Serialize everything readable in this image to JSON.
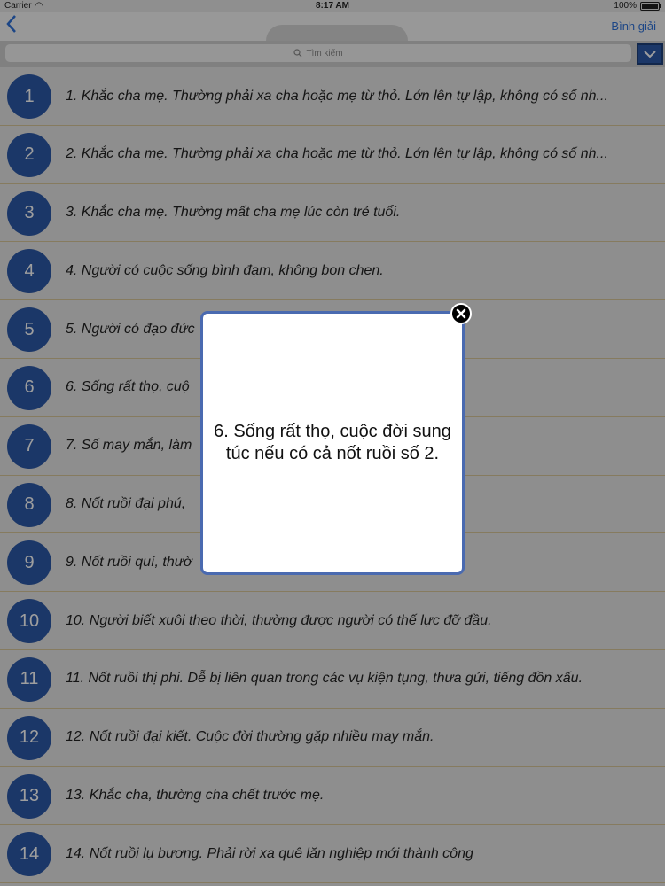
{
  "status_bar": {
    "carrier": "Carrier",
    "time": "8:17 AM",
    "battery": "100%"
  },
  "navbar": {
    "back_icon": "chevron-left-icon",
    "right_label": "Bình giải"
  },
  "search": {
    "placeholder": "Tìm kiếm",
    "dropdown_icon": "chevron-down-icon"
  },
  "items": [
    {
      "number": "1",
      "text": "1. Khắc cha mẹ. Thường phải xa cha hoặc mẹ từ thỏ. Lớn lên tự lập, không có số nh..."
    },
    {
      "number": "2",
      "text": "2. Khắc cha mẹ. Thường phải xa cha hoặc mẹ từ thỏ. Lớn lên tự lập, không có số nh..."
    },
    {
      "number": "3",
      "text": "3. Khắc cha mẹ. Thường mất cha mẹ lúc còn trẻ tuổi."
    },
    {
      "number": "4",
      "text": "4. Người có cuộc sống bình đạm, không bon chen."
    },
    {
      "number": "5",
      "text": "5. Người có đạo đức"
    },
    {
      "number": "6",
      "text": "6. Sống rất thọ, cuộ"
    },
    {
      "number": "7",
      "text": "7. Số may mắn, làm"
    },
    {
      "number": "8",
      "text": "8. Nốt ruồi đại phú,"
    },
    {
      "number": "9",
      "text": "9. Nốt ruồi quí, thườ"
    },
    {
      "number": "10",
      "text": "10. Người biết xuôi theo thời, thường được người có thế lực đỡ đầu."
    },
    {
      "number": "11",
      "text": "11. Nốt ruồi thị phi. Dễ bị liên quan trong các vụ kiện tụng, thưa gửi, tiếng đồn xấu."
    },
    {
      "number": "12",
      "text": "12. Nốt ruồi đại kiết. Cuộc đời thường gặp nhiều may mắn."
    },
    {
      "number": "13",
      "text": "13. Khắc cha, thường cha chết trước mẹ."
    },
    {
      "number": "14",
      "text": "14. Nốt ruồi lụ bương. Phải rời xa quê lăn nghiệp mới thành công"
    }
  ],
  "popup": {
    "text": "6. Sống rất thọ, cuộc đời sung túc nếu có cả nốt ruồi số 2.",
    "close_icon": "close-icon"
  }
}
